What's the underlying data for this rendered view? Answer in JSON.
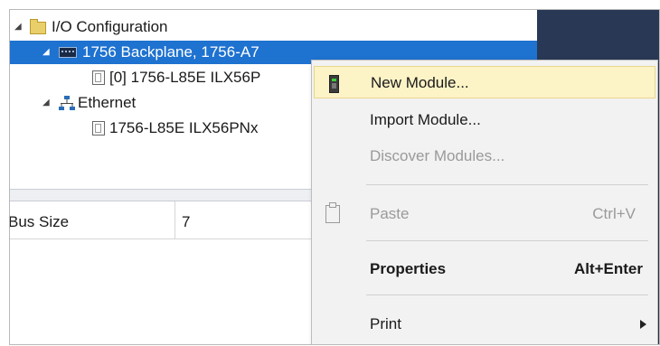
{
  "tree": {
    "io_config": "I/O Configuration",
    "backplane": "1756 Backplane, 1756-A7",
    "slot0_module": "[0] 1756-L85E ILX56P",
    "ethernet": "Ethernet",
    "eth_module": "1756-L85E ILX56PNx"
  },
  "properties": {
    "bus_size_label": "Bus Size",
    "bus_size_value": "7"
  },
  "context_menu": {
    "new_module": "New Module...",
    "import_module": "Import Module...",
    "discover_modules": "Discover Modules...",
    "paste": "Paste",
    "paste_shortcut": "Ctrl+V",
    "properties": "Properties",
    "properties_shortcut": "Alt+Enter",
    "print": "Print"
  },
  "icons": {
    "expand": "expanded-triangle-icon",
    "folder": "folder-icon",
    "backplane": "backplane-icon",
    "module": "module-icon",
    "network": "ethernet-network-icon",
    "new_module": "new-module-icon",
    "paste": "paste-icon",
    "submenu": "submenu-arrow-icon"
  },
  "colors": {
    "selection": "#1e72d0",
    "menu_highlight": "#fcf3c6",
    "dark_panel": "#293955"
  }
}
